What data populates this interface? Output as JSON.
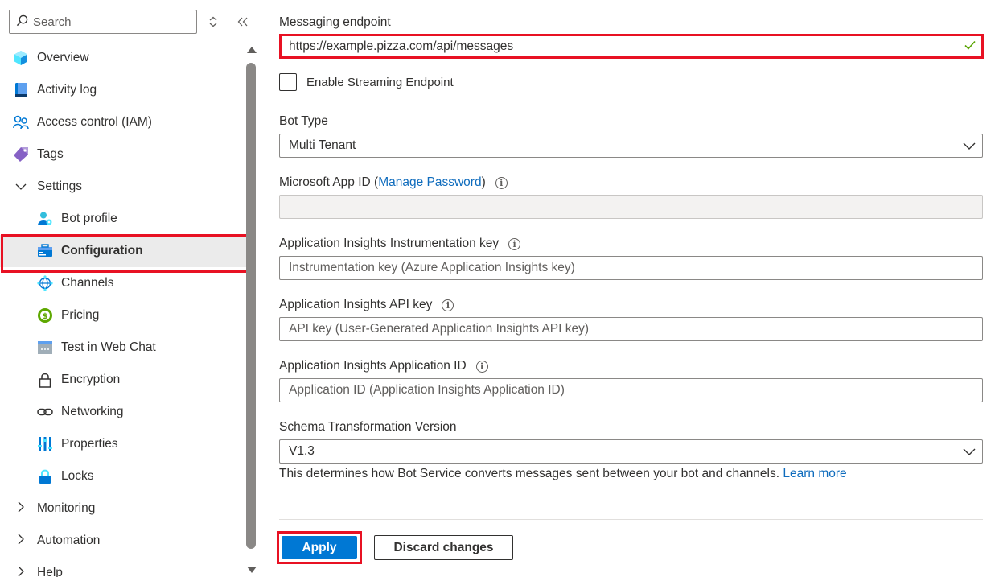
{
  "sidebar": {
    "search_placeholder": "Search",
    "items": [
      {
        "label": "Overview",
        "icon": "overview-icon"
      },
      {
        "label": "Activity log",
        "icon": "activity-log-icon"
      },
      {
        "label": "Access control (IAM)",
        "icon": "people-icon"
      },
      {
        "label": "Tags",
        "icon": "tag-icon"
      },
      {
        "label": "Settings",
        "icon": "chevron-down-icon",
        "expanded": true
      },
      {
        "label": "Bot profile",
        "icon": "bot-profile-icon"
      },
      {
        "label": "Configuration",
        "icon": "configuration-icon",
        "selected": true
      },
      {
        "label": "Channels",
        "icon": "channels-icon"
      },
      {
        "label": "Pricing",
        "icon": "pricing-icon"
      },
      {
        "label": "Test in Web Chat",
        "icon": "web-chat-icon"
      },
      {
        "label": "Encryption",
        "icon": "lock-icon"
      },
      {
        "label": "Networking",
        "icon": "networking-icon"
      },
      {
        "label": "Properties",
        "icon": "properties-icon"
      },
      {
        "label": "Locks",
        "icon": "locks-icon"
      },
      {
        "label": "Monitoring",
        "icon": "chevron-right-icon",
        "expanded": false
      },
      {
        "label": "Automation",
        "icon": "chevron-right-icon",
        "expanded": false
      },
      {
        "label": "Help",
        "icon": "chevron-right-icon",
        "expanded": false
      }
    ]
  },
  "form": {
    "messaging_endpoint": {
      "label": "Messaging endpoint",
      "value": "https://example.pizza.com/api/messages"
    },
    "streaming": {
      "label": "Enable Streaming Endpoint",
      "checked": false
    },
    "bot_type": {
      "label": "Bot Type",
      "value": "Multi Tenant"
    },
    "app_id": {
      "label": "Microsoft App ID (",
      "link": "Manage Password",
      "suffix": ")",
      "value": ""
    },
    "instrumentation_key": {
      "label": "Application Insights Instrumentation key",
      "placeholder": "Instrumentation key (Azure Application Insights key)"
    },
    "api_key": {
      "label": "Application Insights API key",
      "placeholder": "API key (User-Generated Application Insights API key)"
    },
    "application_id": {
      "label": "Application Insights Application ID",
      "placeholder": "Application ID (Application Insights Application ID)"
    },
    "schema_version": {
      "label": "Schema Transformation Version",
      "value": "V1.3",
      "help": "This determines how Bot Service converts messages sent between your bot and channels.",
      "help_link": "Learn more"
    }
  },
  "actions": {
    "apply": "Apply",
    "discard": "Discard changes"
  },
  "colors": {
    "accent": "#0078d4",
    "highlight": "#e81123",
    "valid": "#57a300"
  }
}
